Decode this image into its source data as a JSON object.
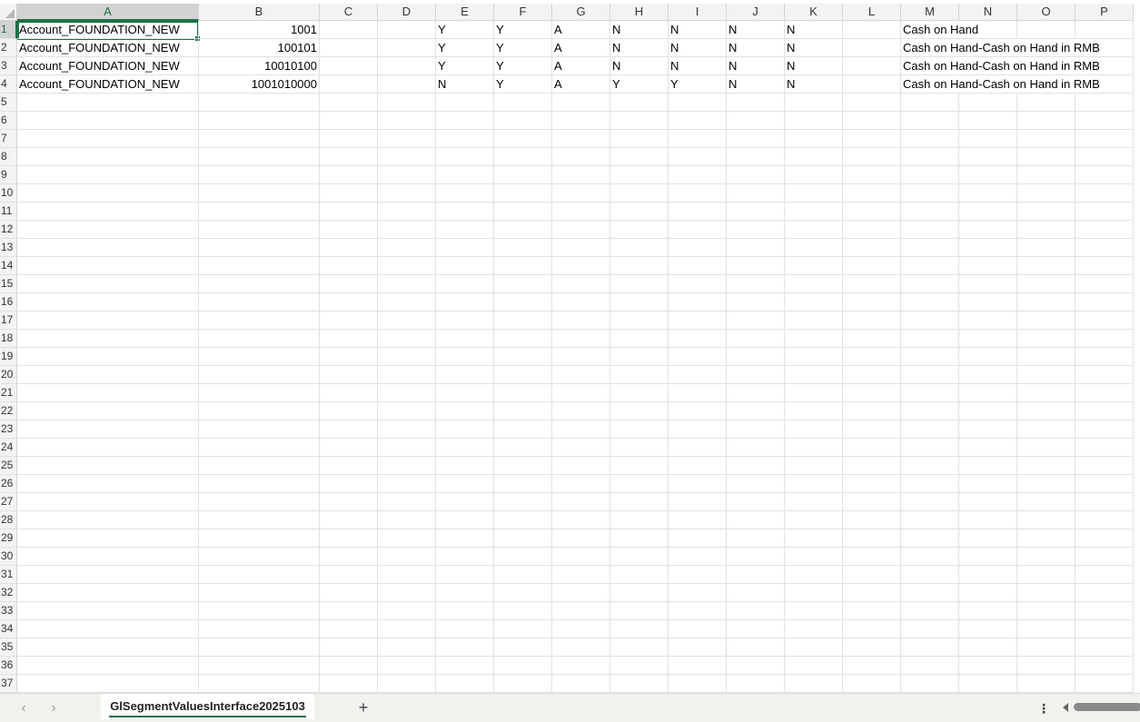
{
  "columns": [
    "A",
    "B",
    "C",
    "D",
    "E",
    "F",
    "G",
    "H",
    "I",
    "J",
    "K",
    "L",
    "M",
    "N",
    "O",
    "P"
  ],
  "rows": [
    "1",
    "2",
    "3",
    "4",
    "5",
    "6",
    "7",
    "8",
    "9",
    "10",
    "11",
    "12",
    "13",
    "14",
    "15",
    "16",
    "17",
    "18",
    "19",
    "20",
    "21",
    "22",
    "23",
    "24",
    "25",
    "26",
    "27",
    "28",
    "29",
    "30",
    "31",
    "32",
    "33",
    "34",
    "35",
    "36",
    "37"
  ],
  "selected_cell": "A1",
  "cells": [
    {
      "A": "Account_FOUNDATION_NEW",
      "B": "1001",
      "E": "Y",
      "F": "Y",
      "G": "A",
      "H": "N",
      "I": "N",
      "J": "N",
      "K": "N",
      "M": "Cash on Hand"
    },
    {
      "A": "Account_FOUNDATION_NEW",
      "B": "100101",
      "E": "Y",
      "F": "Y",
      "G": "A",
      "H": "N",
      "I": "N",
      "J": "N",
      "K": "N",
      "M": "Cash on Hand-Cash on Hand in RMB"
    },
    {
      "A": "Account_FOUNDATION_NEW",
      "B": "10010100",
      "E": "Y",
      "F": "Y",
      "G": "A",
      "H": "N",
      "I": "N",
      "J": "N",
      "K": "N",
      "M": "Cash on Hand-Cash on Hand in RMB"
    },
    {
      "A": "Account_FOUNDATION_NEW",
      "B": "1001010000",
      "E": "N",
      "F": "Y",
      "G": "A",
      "H": "Y",
      "I": "Y",
      "J": "N",
      "K": "N",
      "M": "Cash on Hand-Cash on Hand in RMB"
    }
  ],
  "tabbar": {
    "prev_icon": "chevron-left-icon",
    "next_icon": "chevron-right-icon",
    "prev_glyph": "‹",
    "next_glyph": "›",
    "sheet_tab_label": "GlSegmentValuesInterface2025103",
    "add_sheet_label": "+",
    "more_label": "⋮"
  },
  "colors": {
    "accent": "#1e7145",
    "header_bg": "#f3f3f3",
    "selected_header_bg": "#d2d2d2",
    "gridline": "#e1e1e1"
  }
}
